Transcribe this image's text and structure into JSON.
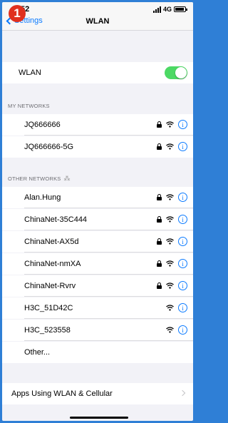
{
  "status_bar": {
    "time": "52",
    "network": "4G"
  },
  "badge": "1",
  "nav": {
    "back_label": "Settings",
    "title": "WLAN"
  },
  "wlan_row": {
    "label": "WLAN",
    "enabled": true
  },
  "sections": {
    "my_networks": "MY NETWORKS",
    "other_networks": "OTHER NETWORKS"
  },
  "my_networks": [
    {
      "name": "JQ666666",
      "secured": true
    },
    {
      "name": "JQ666666-5G",
      "secured": true
    }
  ],
  "other_networks": [
    {
      "name": "Alan.Hung",
      "secured": true
    },
    {
      "name": "ChinaNet-35C444",
      "secured": true
    },
    {
      "name": "ChinaNet-AX5d",
      "secured": true
    },
    {
      "name": "ChinaNet-nmXA",
      "secured": true
    },
    {
      "name": "ChinaNet-Rvrv",
      "secured": true
    },
    {
      "name": "H3C_51D42C",
      "secured": false
    },
    {
      "name": "H3C_523558",
      "secured": false
    },
    {
      "name": "Other...",
      "secured": false,
      "no_icons": true
    }
  ],
  "apps_row": {
    "label": "Apps Using WLAN & Cellular"
  },
  "colors": {
    "accent": "#0a7aff",
    "toggle_on": "#4cd964",
    "frame": "#2f7fd6",
    "badge": "#e0301e"
  }
}
